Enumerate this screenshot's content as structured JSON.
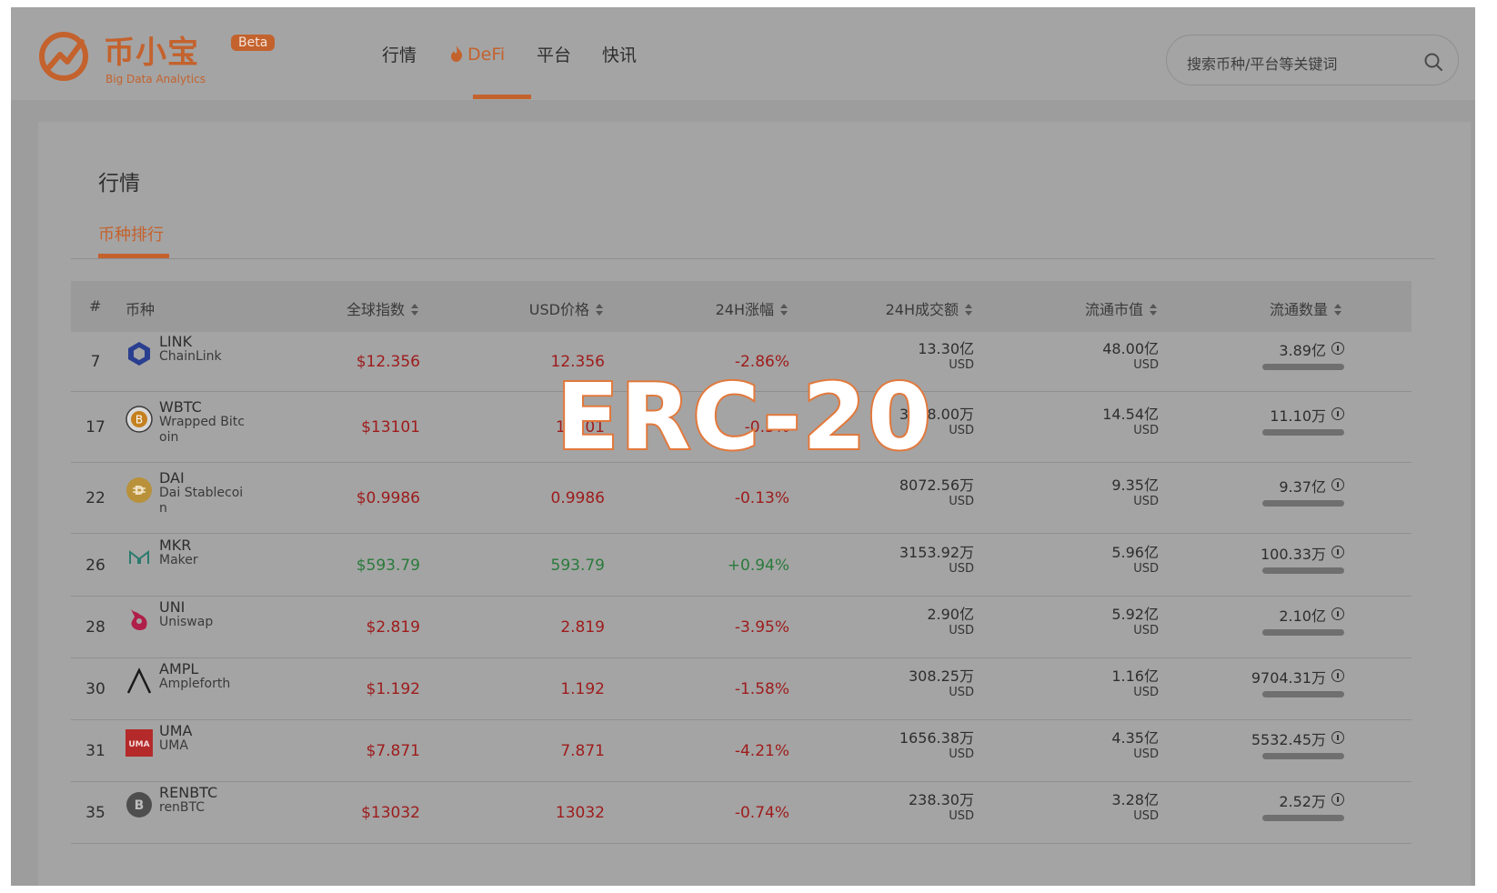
{
  "brand": {
    "name": "币小宝",
    "subtitle": "Big Data Analytics",
    "badge": "Beta",
    "color": "#c4622d"
  },
  "nav": {
    "items": [
      "行情",
      "DeFi",
      "平台",
      "快讯"
    ],
    "active": "DeFi"
  },
  "search": {
    "placeholder": "搜索币种/平台等关键词"
  },
  "page": {
    "title": "行情",
    "tab": "币种排行"
  },
  "table": {
    "headers": {
      "idx": "#",
      "coin": "币种",
      "global_index": "全球指数",
      "usd_price": "USD价格",
      "change": "24H涨幅",
      "volume": "24H成交额",
      "market_cap": "流通市值",
      "supply": "流通数量"
    },
    "rows": [
      {
        "rank": "7",
        "symbol": "LINK",
        "name": "ChainLink",
        "icon": "chainlink-icon",
        "global_index": "$12.356",
        "usd_price": "12.356",
        "change": "-2.86%",
        "volume": "13.30亿",
        "volume_unit": "USD",
        "market_cap": "48.00亿",
        "market_cap_unit": "USD",
        "supply": "3.89亿",
        "direction": "down"
      },
      {
        "rank": "17",
        "symbol": "WBTC",
        "name": "Wrapped Bitcoin",
        "icon": "wbtc-icon",
        "global_index": "$13101",
        "usd_price": "13101",
        "change": "-0.3%",
        "volume": "3078.00万",
        "volume_unit": "USD",
        "market_cap": "14.54亿",
        "market_cap_unit": "USD",
        "supply": "11.10万",
        "direction": "down"
      },
      {
        "rank": "22",
        "symbol": "DAI",
        "name": "Dai Stablecoin",
        "icon": "dai-icon",
        "global_index": "$0.9986",
        "usd_price": "0.9986",
        "change": "-0.13%",
        "volume": "8072.56万",
        "volume_unit": "USD",
        "market_cap": "9.35亿",
        "market_cap_unit": "USD",
        "supply": "9.37亿",
        "direction": "down"
      },
      {
        "rank": "26",
        "symbol": "MKR",
        "name": "Maker",
        "icon": "maker-icon",
        "global_index": "$593.79",
        "usd_price": "593.79",
        "change": "+0.94%",
        "volume": "3153.92万",
        "volume_unit": "USD",
        "market_cap": "5.96亿",
        "market_cap_unit": "USD",
        "supply": "100.33万",
        "direction": "up"
      },
      {
        "rank": "28",
        "symbol": "UNI",
        "name": "Uniswap",
        "icon": "uniswap-icon",
        "global_index": "$2.819",
        "usd_price": "2.819",
        "change": "-3.95%",
        "volume": "2.90亿",
        "volume_unit": "USD",
        "market_cap": "5.92亿",
        "market_cap_unit": "USD",
        "supply": "2.10亿",
        "direction": "down"
      },
      {
        "rank": "30",
        "symbol": "AMPL",
        "name": "Ampleforth",
        "icon": "ampleforth-icon",
        "global_index": "$1.192",
        "usd_price": "1.192",
        "change": "-1.58%",
        "volume": "308.25万",
        "volume_unit": "USD",
        "market_cap": "1.16亿",
        "market_cap_unit": "USD",
        "supply": "9704.31万",
        "direction": "down"
      },
      {
        "rank": "31",
        "symbol": "UMA",
        "name": "UMA",
        "icon": "uma-icon",
        "global_index": "$7.871",
        "usd_price": "7.871",
        "change": "-4.21%",
        "volume": "1656.38万",
        "volume_unit": "USD",
        "market_cap": "4.35亿",
        "market_cap_unit": "USD",
        "supply": "5532.45万",
        "direction": "down"
      },
      {
        "rank": "35",
        "symbol": "RENBTC",
        "name": "renBTC",
        "icon": "renbtc-icon",
        "global_index": "$13032",
        "usd_price": "13032",
        "change": "-0.74%",
        "volume": "238.30万",
        "volume_unit": "USD",
        "market_cap": "3.28亿",
        "market_cap_unit": "USD",
        "supply": "2.52万",
        "direction": "down"
      }
    ]
  },
  "overlay": {
    "text": "ERC-20"
  }
}
